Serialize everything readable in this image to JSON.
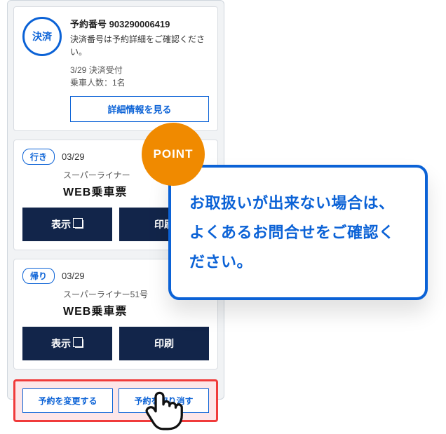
{
  "reservation": {
    "status_label": "決済",
    "number_label": "予約番号 903290006419",
    "note": "決済番号は予約詳細をご確認ください。",
    "date_status": "3/29 決済受付",
    "passengers": "乗車人数：1名",
    "detail_button": "詳細情報を見る"
  },
  "trips": {
    "outbound": {
      "tag": "行き",
      "date": "03/29",
      "line": "スーパーライナー",
      "ticket": "WEB乗車票"
    },
    "return": {
      "tag": "帰り",
      "date": "03/29",
      "line": "スーパーライナー51号",
      "ticket": "WEB乗車票"
    }
  },
  "buttons": {
    "show": "表示",
    "print": "印刷",
    "change": "予約を変更する",
    "cancel": "予約を取り消す"
  },
  "callout": {
    "badge": "POINT",
    "text": "お取扱いが出来ない場合は、よくあるお問合せをご確認ください。"
  }
}
